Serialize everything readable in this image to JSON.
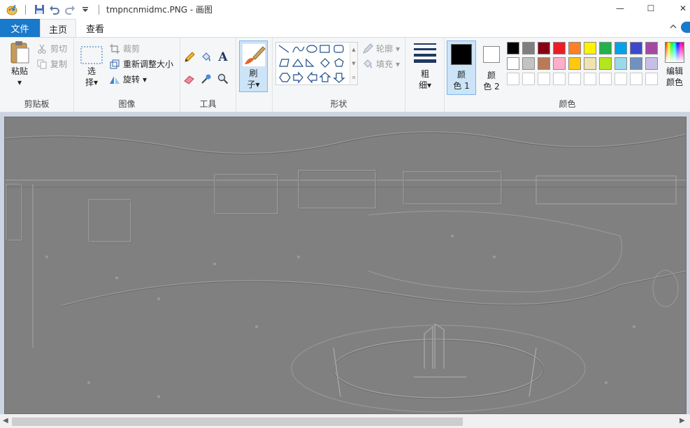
{
  "window": {
    "title": "tmpncnmidmc.PNG - 画图",
    "controls": {
      "minimize": "—",
      "maximize": "☐",
      "close": "✕"
    }
  },
  "tabs": {
    "file": "文件",
    "home": "主页",
    "view": "查看"
  },
  "clipboard": {
    "paste": "粘贴",
    "cut": "剪切",
    "copy": "复制",
    "label": "剪贴板"
  },
  "image": {
    "select_l1": "选",
    "select_l2": "择",
    "crop": "裁剪",
    "resize": "重新调整大小",
    "rotate": "旋转",
    "label": "图像"
  },
  "tools": {
    "label": "工具"
  },
  "brush": {
    "l1": "刷",
    "l2": "子"
  },
  "shapes": {
    "outline": "轮廓",
    "fill": "填充",
    "label": "形状"
  },
  "size": {
    "l1": "粗",
    "l2": "细"
  },
  "colors": {
    "color1_l1": "颜",
    "color1_l2": "色 1",
    "color2_l1": "颜",
    "color2_l2": "色 2",
    "edit_l1": "编辑",
    "edit_l2": "颜色",
    "label": "颜色",
    "color1_value": "#000000",
    "color2_value": "#ffffff",
    "palette_row1": [
      "#000000",
      "#7f7f7f",
      "#880015",
      "#ed1c24",
      "#ff7f27",
      "#fff200",
      "#22b14c",
      "#00a2e8",
      "#3f48cc",
      "#a349a4"
    ],
    "palette_row2": [
      "#ffffff",
      "#c3c3c3",
      "#b97a57",
      "#ffaec9",
      "#ffc90e",
      "#efe4b0",
      "#b5e61d",
      "#99d9ea",
      "#7092be",
      "#c8bfe7"
    ]
  },
  "accent": "#1979ca"
}
